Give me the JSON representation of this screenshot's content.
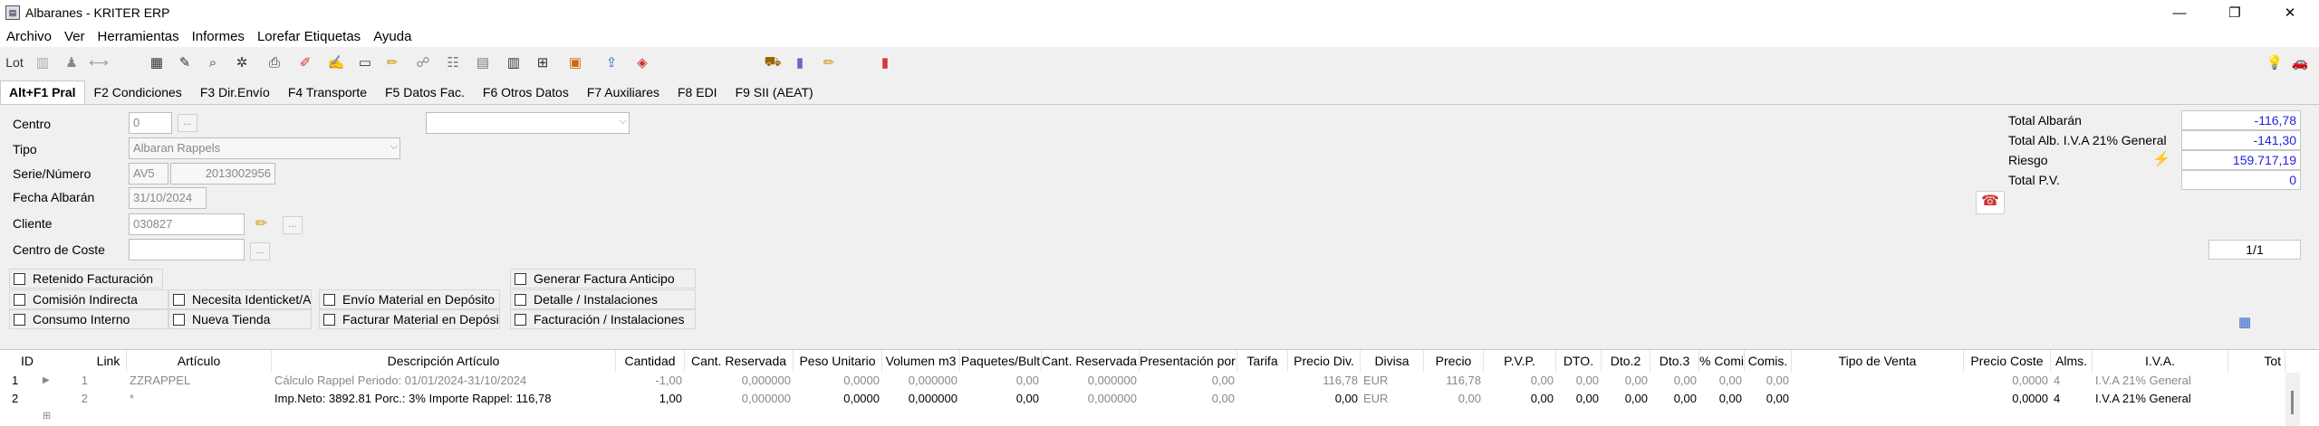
{
  "window": {
    "title": "Albaranes - KRITER ERP",
    "minimize": "—",
    "restore": "❐",
    "close": "✕"
  },
  "menu": [
    "Archivo",
    "Ver",
    "Herramientas",
    "Informes",
    "Lorefar Etiquetas",
    "Ayuda"
  ],
  "toolbar": {
    "lot_label": "Lot",
    "icons": [
      "scan-icon",
      "user-icon",
      "sync-icon",
      "folder-icon",
      "edit-icon",
      "preview-icon",
      "tools-icon",
      "print-icon",
      "erase-icon",
      "notes-icon",
      "window-icon",
      "pin-icon",
      "attach-icon",
      "tree-icon",
      "image-icon",
      "barcode-icon",
      "flow-icon",
      "photo-icon",
      "export-icon",
      "doc-icon",
      "truck-icon",
      "bottle-icon",
      "edit2-icon",
      "battery-icon",
      "bulb-icon",
      "car-icon"
    ]
  },
  "tabs": [
    "Alt+F1 Pral",
    "F2 Condiciones",
    "F3 Dir.Envío",
    "F4 Transporte",
    "F5 Datos Fac.",
    "F6 Otros Datos",
    "F7 Auxiliares",
    "F8 EDI",
    "F9 SII (AEAT)"
  ],
  "form": {
    "centro": {
      "label": "Centro",
      "value": "0",
      "btn": "..."
    },
    "tipo": {
      "label": "Tipo",
      "value": "Albaran Rappels"
    },
    "serie": {
      "label": "Serie/Número",
      "serie": "AV5",
      "numero": "2013002956"
    },
    "fecha": {
      "label": "Fecha Albarán",
      "value": "31/10/2024"
    },
    "cliente": {
      "label": "Cliente",
      "value": "030827",
      "btn": "..."
    },
    "coste": {
      "label": "Centro de Coste",
      "value": "",
      "btn": "..."
    },
    "extra_dropdown": ""
  },
  "checks": [
    "Retenido Facturación",
    "Comisión Indirecta",
    "Necesita Identicket/A",
    "Envío Material en Depósito",
    "Consumo Interno",
    "Nueva Tienda",
    "Facturar Material en Depósito",
    "Generar Factura Anticipo",
    "Detalle / Instalaciones",
    "Facturación / Instalaciones"
  ],
  "totals": [
    {
      "label": "Total Albarán",
      "value": "-116,78"
    },
    {
      "label": "Total Alb. I.V.A 21% General",
      "value": "-141,30"
    },
    {
      "label": "Riesgo",
      "value": "159.717,19"
    },
    {
      "label": "Total P.V.",
      "value": "0"
    }
  ],
  "pager": "1/1",
  "grid": {
    "headers": [
      "ID",
      "Link",
      "Artículo",
      "Descripción Artículo",
      "Cantidad",
      "Cant. Reservada",
      "Peso Unitario",
      "Volumen m3",
      "Paquetes/Bult",
      "Cant. Reservada U.",
      "Presentación por Pa",
      "Tarifa",
      "Precio Div.",
      "Divisa",
      "Precio",
      "P.V.P.",
      "DTO.",
      "Dto.2",
      "Dto.3",
      "% Comisió",
      "Comis.",
      "Tipo de Venta",
      "Precio Coste",
      "Alms.",
      "I.V.A.",
      "Tot"
    ],
    "rows": [
      {
        "n": "1",
        "id": "1",
        "link": "",
        "articulo": "ZZRAPPEL",
        "desc": "Cálculo Rappel Periodo: 01/01/2024-31/10/2024",
        "cantidad": "-1,00",
        "reservada": "0,000000",
        "peso": "0,0000",
        "vol": "0,000000",
        "paq": "0,00",
        "resu": "0,000000",
        "pres": "0,00",
        "tarifa": "",
        "pdiv": "116,78",
        "divisa": "EUR",
        "precio": "116,78",
        "pvp": "0,00",
        "dto": "0,00",
        "dto2": "0,00",
        "dto3": "0,00",
        "comp": "0,00",
        "comis": "0,00",
        "tventa": "",
        "pcoste": "0,0000",
        "alms": "4",
        "iva": "I.V.A 21% General"
      },
      {
        "n": "2",
        "id": "2",
        "link": "",
        "articulo": "*",
        "desc": "Imp.Neto: 3892.81 Porc.: 3% Importe Rappel: 116,78",
        "cantidad": "1,00",
        "reservada": "0,000000",
        "peso": "0,0000",
        "vol": "0,000000",
        "paq": "0,00",
        "resu": "0,000000",
        "pres": "0,00",
        "tarifa": "",
        "pdiv": "0,00",
        "divisa": "EUR",
        "precio": "0,00",
        "pvp": "0,00",
        "dto": "0,00",
        "dto2": "0,00",
        "dto3": "0,00",
        "comp": "0,00",
        "comis": "0,00",
        "tventa": "",
        "pcoste": "0,0000",
        "alms": "4",
        "iva": "I.V.A 21% General"
      }
    ]
  }
}
